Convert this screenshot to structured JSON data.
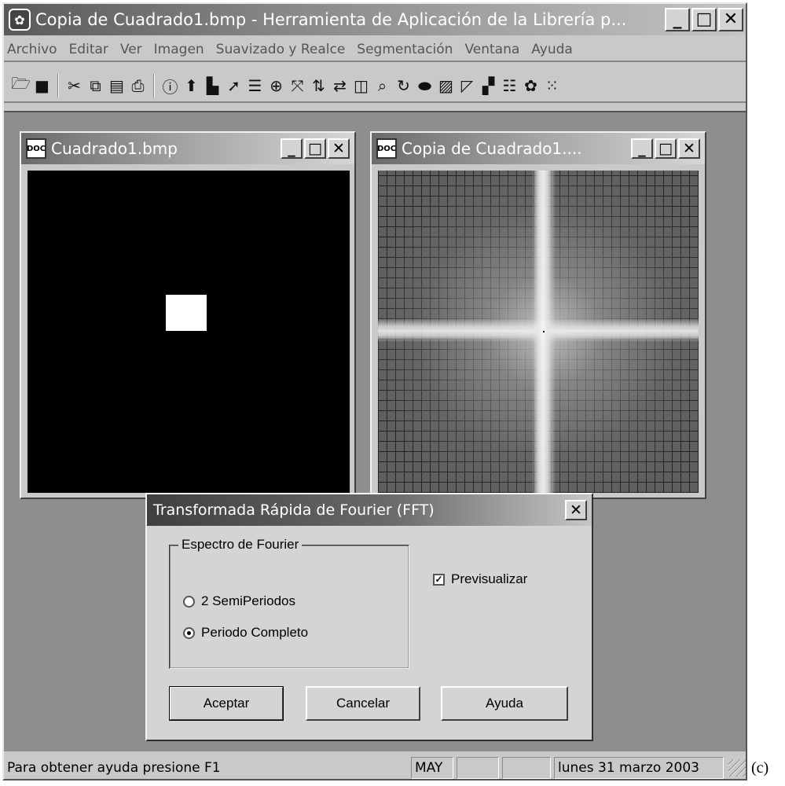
{
  "app": {
    "title": "Copia de Cuadrado1.bmp - Herramienta de Aplicación de la Librería p...",
    "icon": "app-palette-icon"
  },
  "menu": [
    "Archivo",
    "Editar",
    "Ver",
    "Imagen",
    "Suavizado y Realce",
    "Segmentación",
    "Ventana",
    "Ayuda"
  ],
  "toolbar": {
    "groups": [
      [
        "open-icon",
        "save-icon"
      ],
      [
        "cut-icon",
        "copy-icon",
        "paste-icon",
        "print-icon"
      ],
      [
        "info-icon",
        "up-arrow-icon",
        "histogram-icon",
        "arrow-icon",
        "list-icon",
        "and-or-icon",
        "stretch-icon",
        "flip-vertical-icon",
        "flip-horizontal-icon",
        "layers-icon",
        "zoom-icon",
        "rotate-icon",
        "ellipse-icon",
        "pattern-icon",
        "crop-icon",
        "mosaic-icon",
        "stack-icon",
        "palette-icon",
        "noise-icon"
      ]
    ]
  },
  "windows": [
    {
      "title": "Cuadrado1.bmp"
    },
    {
      "title": "Copia de Cuadrado1...."
    }
  ],
  "dialog": {
    "title": "Transformada Rápida de Fourier (FFT)",
    "group_label": "Espectro de Fourier",
    "options": [
      {
        "label": "2 SemiPeriodos",
        "selected": false
      },
      {
        "label": "Periodo Completo",
        "selected": true
      }
    ],
    "preview_label": "Previsualizar",
    "preview_checked": true,
    "buttons": {
      "ok": "Aceptar",
      "cancel": "Cancelar",
      "help": "Ayuda"
    }
  },
  "status": {
    "message": "Para obtener ayuda presione F1",
    "caps": "MAY",
    "date": "lunes 31 marzo 2003"
  },
  "caption": "(c)",
  "win_buttons": {
    "minimize": "_",
    "maximize": "□",
    "close": "✕"
  }
}
